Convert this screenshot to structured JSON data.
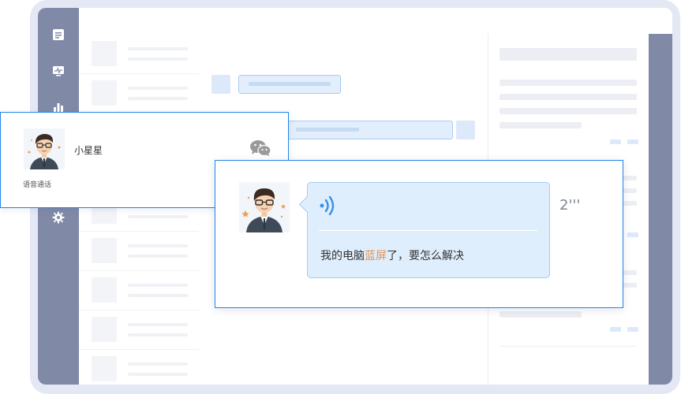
{
  "sidebar": {
    "icons": [
      "message-list-icon",
      "monitor-icon",
      "chart-icon",
      "settings-icon"
    ]
  },
  "contact": {
    "name": "小星星",
    "call_type": "语音通话",
    "channel_icon": "wechat-icon"
  },
  "voice_message": {
    "transcript_before": "我的电脑",
    "transcript_highlight": "蓝屏",
    "transcript_after": "了，要怎么解决",
    "duration": "2'''",
    "icon": "voice-wave-icon"
  },
  "colors": {
    "sidebar_bg": "#8089a6",
    "accent_border": "#1f86ea",
    "bubble_bg": "#dfeefc",
    "highlight_text": "#e2935a"
  }
}
